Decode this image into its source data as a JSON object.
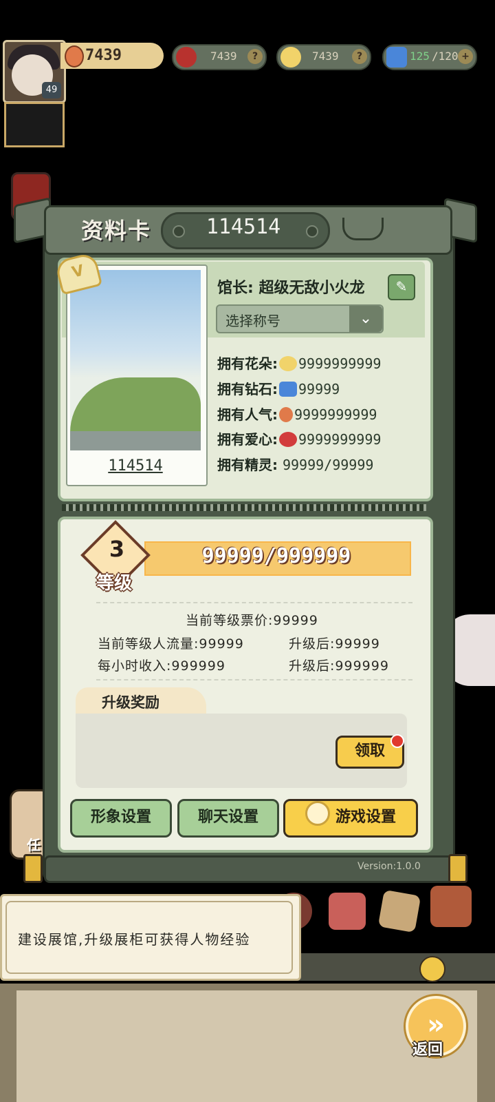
{
  "top_bar": {
    "avatar_level": "49",
    "popularity": "7439",
    "hearts": "7439",
    "flowers": "7439",
    "gems_current": "125",
    "gems_max": "/120",
    "help_label": "?",
    "add_label": "+"
  },
  "card": {
    "header_title": "资料卡",
    "player_id": "114514",
    "vip_badge": "V",
    "photo_id": "114514",
    "owner": "馆长: 超级无敌小火龙",
    "edit_icon": "✎",
    "title_select": "选择称号",
    "dropdown_icon": "⌄",
    "stats": [
      {
        "label": "拥有花朵:",
        "value": "9999999999",
        "icon_color": "#f1d36a"
      },
      {
        "label": "拥有钻石:",
        "value": "99999",
        "icon_color": "#4a86d9"
      },
      {
        "label": "拥有人气:",
        "value": "9999999999",
        "icon_color": "#e07a4a"
      },
      {
        "label": "拥有爱心:",
        "value": "9999999999",
        "icon_color": "#d23c3c"
      },
      {
        "label": "拥有精灵:",
        "value": "99999/99999",
        "icon_color": ""
      }
    ]
  },
  "level": {
    "number": "3",
    "label": "等级",
    "exp": "99999/999999",
    "ticket_price": "当前等级票价:99999",
    "traffic": "当前等级人流量:99999",
    "traffic_after": "升级后:99999",
    "hourly_income": "每小时收入:999999",
    "income_after": "升级后:999999",
    "reward_title": "升级奖励",
    "claim_label": "领取"
  },
  "buttons": {
    "appearance": "形象设置",
    "chat": "聊天设置",
    "game": "游戏设置"
  },
  "version": "Version:1.0.0",
  "side_left_label": "任",
  "tip": "建设展馆,升级展柜可获得人物经验",
  "back_label": "返回",
  "back_icon": "»"
}
